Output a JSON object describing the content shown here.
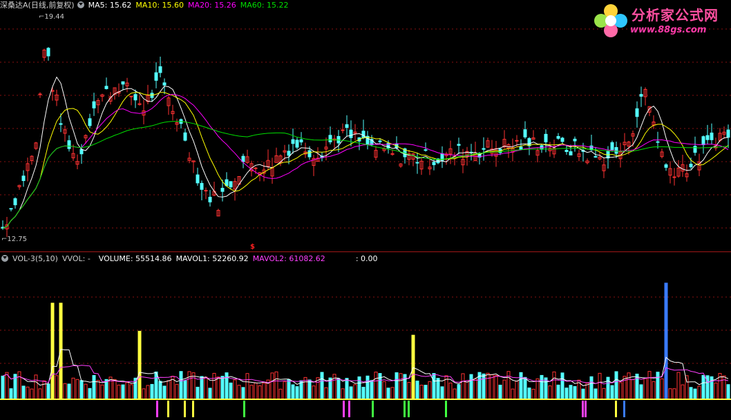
{
  "price_panel": {
    "stock_title": "深桑达A(日线,前复权)",
    "ma5": "MA5: 15.62",
    "ma10": "MA10: 15.60",
    "ma20": "MA20: 15.26",
    "ma60": "MA60: 15.22",
    "high_label": "19.44",
    "low_label": "12.75",
    "colors": {
      "up": "#ff3232",
      "down": "#54ffff",
      "ma5": "#ffffff",
      "ma10": "#ffff00",
      "ma20": "#ff00ff",
      "ma60": "#00e000"
    }
  },
  "signal_mark": "$",
  "volume_panel": {
    "indicator": "VOL-3(5,10)",
    "vvol": "VVOL: -",
    "volume": "VOLUME: 55514.86",
    "mavol1": "MAVOL1: 52260.92",
    "mavol2": "MAVOL2: 61082.62",
    "extra": ": 0.00"
  },
  "logo": {
    "title": "分析家公式网",
    "url": "www.88gs.com"
  },
  "icons": {
    "settings": "dropdown-circle-icon",
    "logo": "flower-logo-icon"
  },
  "chart_data": {
    "type": "candlestick",
    "price_range": [
      12.75,
      19.44
    ],
    "grid": "dashed-horizontal",
    "volume_series": [
      "VOLUME",
      "MAVOL1",
      "MAVOL2"
    ]
  }
}
